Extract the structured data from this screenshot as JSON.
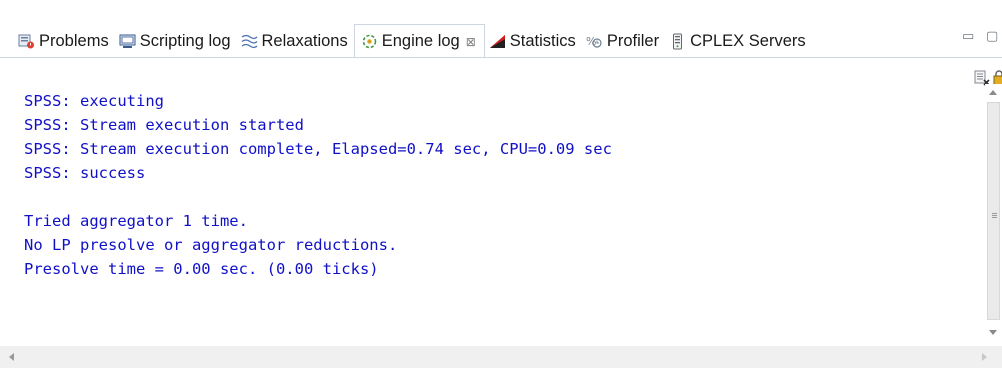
{
  "tabs": [
    {
      "label": "Problems",
      "icon": "problems-icon"
    },
    {
      "label": "Scripting log",
      "icon": "scripting-log-icon"
    },
    {
      "label": "Relaxations",
      "icon": "relaxations-icon"
    },
    {
      "label": "Engine log",
      "icon": "engine-log-icon",
      "active": true,
      "close_glyph": "⊠"
    },
    {
      "label": "Statistics",
      "icon": "statistics-icon"
    },
    {
      "label": "Profiler",
      "icon": "profiler-icon"
    },
    {
      "label": "CPLEX Servers",
      "icon": "cplex-servers-icon"
    }
  ],
  "window_controls": {
    "minimize": "▭",
    "maximize": "▢"
  },
  "toolbar": {
    "icons": [
      "clear-console-icon",
      "scroll-lock-icon"
    ]
  },
  "log": {
    "lines": [
      "SPSS: executing",
      "SPSS: Stream execution started",
      "SPSS: Stream execution complete, Elapsed=0.74 sec, CPU=0.09 sec",
      "SPSS: success",
      "",
      "Tried aggregator 1 time.",
      "No LP presolve or aggregator reductions.",
      "Presolve time = 0.00 sec. (0.00 ticks)"
    ],
    "text_color": "#1010c8"
  }
}
